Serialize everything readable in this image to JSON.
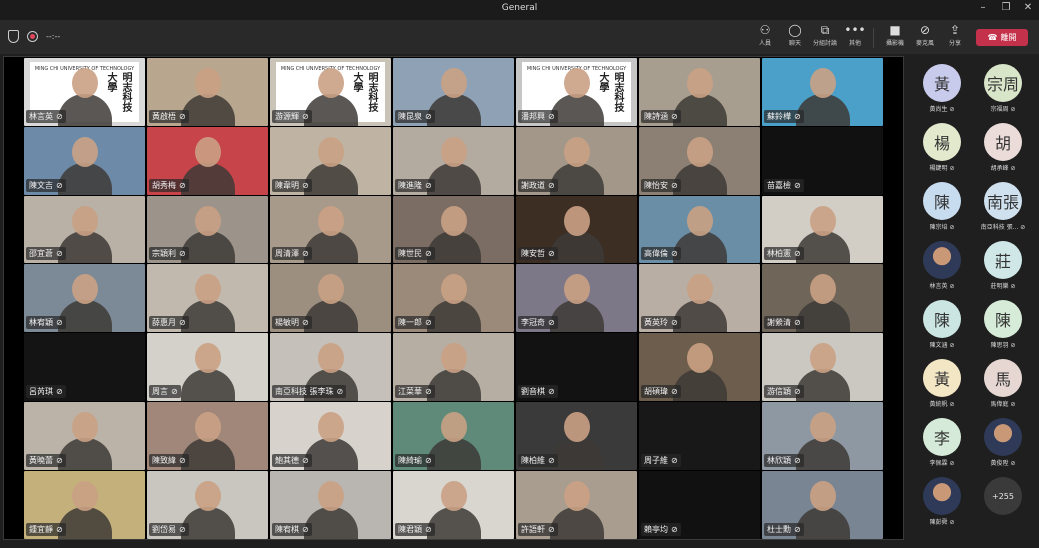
{
  "window": {
    "title": "General"
  },
  "meeting": {
    "timer": "--:--"
  },
  "toolbar": {
    "people": "人員",
    "chat": "聊天",
    "rooms": "分組討論",
    "more": "其他",
    "camera": "攝影機",
    "mic": "麥克風",
    "share": "分享",
    "leave": "離開"
  },
  "tiles": [
    {
      "name": "林言英",
      "bg": "#d9d9d9",
      "logo": true
    },
    {
      "name": "黃啟梧",
      "bg": "#b8a68e"
    },
    {
      "name": "游源輝",
      "bg": "#c9c3b8",
      "logo": true
    },
    {
      "name": "陳昆泉",
      "bg": "#8fa2b5"
    },
    {
      "name": "潘邦興",
      "bg": "#c6c6c6",
      "logo": true
    },
    {
      "name": "陳詩涵",
      "bg": "#a89e8f"
    },
    {
      "name": "蘇鈴樺",
      "bg": "#4aa0c8"
    },
    {
      "name": "陳文吉",
      "bg": "#6d8aa8"
    },
    {
      "name": "胡秀梅",
      "bg": "#c7444a"
    },
    {
      "name": "陳韋明",
      "bg": "#bfb4a3"
    },
    {
      "name": "陳進隆",
      "bg": "#b3aaa0"
    },
    {
      "name": "謝政道",
      "bg": "#a3978a"
    },
    {
      "name": "陳怡安",
      "bg": "#8c8074"
    },
    {
      "name": "苗嘉檢",
      "bg": "#111111"
    },
    {
      "name": "邵宜蒼",
      "bg": "#b9b1a5"
    },
    {
      "name": "宗穎利",
      "bg": "#9c938a"
    },
    {
      "name": "周清澤",
      "bg": "#a89a8a"
    },
    {
      "name": "陳世民",
      "bg": "#7b6d64"
    },
    {
      "name": "陳安哲",
      "bg": "#3d2e24"
    },
    {
      "name": "高偉倫",
      "bg": "#6a8ea6"
    },
    {
      "name": "林柏憲",
      "bg": "#d2cdc5"
    },
    {
      "name": "林宥穎",
      "bg": "#7b8a96"
    },
    {
      "name": "薛惠月",
      "bg": "#c2b9ae"
    },
    {
      "name": "楊敏明",
      "bg": "#9c8f80"
    },
    {
      "name": "陳一郎",
      "bg": "#9b8a79"
    },
    {
      "name": "李冠奇",
      "bg": "#7d7888"
    },
    {
      "name": "黃英玲",
      "bg": "#b8aea3"
    },
    {
      "name": "謝縈清",
      "bg": "#6f6559"
    },
    {
      "name": "呂芮琪",
      "bg": "#141414"
    },
    {
      "name": "周言",
      "bg": "#d4d0ca"
    },
    {
      "name": "南亞科技 張李珠",
      "bg": "#c5c0ba"
    },
    {
      "name": "江菜華",
      "bg": "#b7aea3"
    },
    {
      "name": "劉音棋",
      "bg": "#121212"
    },
    {
      "name": "胡碩瑋",
      "bg": "#6d5d4c"
    },
    {
      "name": "游信穎",
      "bg": "#cbc7c1"
    },
    {
      "name": "黃曉蕾",
      "bg": "#bcb3a8"
    },
    {
      "name": "陳致緯",
      "bg": "#a0877a"
    },
    {
      "name": "鮑其德",
      "bg": "#d7d2cc"
    },
    {
      "name": "陳綺瑜",
      "bg": "#5f8a7a"
    },
    {
      "name": "陳柏維",
      "bg": "#3a3a3a"
    },
    {
      "name": "周子維",
      "bg": "#181818"
    },
    {
      "name": "林欣穎",
      "bg": "#8e98a3"
    },
    {
      "name": "鍾宜靜",
      "bg": "#c4b07a"
    },
    {
      "name": "劉岱易",
      "bg": "#c9c5bf"
    },
    {
      "name": "陳宥棋",
      "bg": "#b9b6b1"
    },
    {
      "name": "陳君穎",
      "bg": "#d9d5cf"
    },
    {
      "name": "許語軒",
      "bg": "#a99d90"
    },
    {
      "name": "賴亭均",
      "bg": "#111111"
    },
    {
      "name": "杜士勳",
      "bg": "#7a8593"
    }
  ],
  "logo_text": {
    "en": "MING CHI UNIVERSITY OF TECHNOLOGY",
    "cn": "明志科技大學"
  },
  "participants": [
    {
      "avatar": "黃",
      "name": "黃尚生",
      "color": "#c8cbeb"
    },
    {
      "avatar": "宗周",
      "name": "宗福周",
      "color": "#d9e5c9"
    },
    {
      "avatar": "楊",
      "name": "楊鍵明",
      "color": "#e2e9cd"
    },
    {
      "avatar": "胡",
      "name": "胡承峰",
      "color": "#ebdcda"
    },
    {
      "avatar": "陳",
      "name": "陳宗培",
      "color": "#c7dcef"
    },
    {
      "avatar": "南張",
      "name": "南亞科技 張...",
      "color": "#cfe0ef"
    },
    {
      "avatar": "",
      "name": "林言英",
      "color": "",
      "photo": true
    },
    {
      "avatar": "莊",
      "name": "莊明樂",
      "color": "#cfe8e7"
    },
    {
      "avatar": "陳",
      "name": "陳文涵",
      "color": "#cbe5e2"
    },
    {
      "avatar": "陳",
      "name": "陳思羽",
      "color": "#d7ecd8"
    },
    {
      "avatar": "黃",
      "name": "黃統帆",
      "color": "#f3e6c5"
    },
    {
      "avatar": "馬",
      "name": "馬偉庭",
      "color": "#e6d7d3"
    },
    {
      "avatar": "李",
      "name": "李佩霖",
      "color": "#d5ead8"
    },
    {
      "avatar": "",
      "name": "黃俊陞",
      "color": "",
      "photo": true
    },
    {
      "avatar": "",
      "name": "陳彭舜",
      "color": "",
      "photo": true
    },
    {
      "avatar": "+255",
      "name": "",
      "color": "",
      "plus": true
    }
  ]
}
